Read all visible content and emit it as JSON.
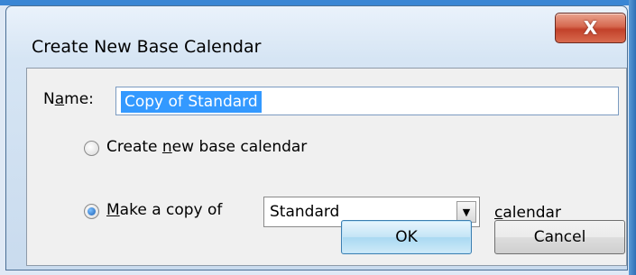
{
  "dialog": {
    "title": "Create New Base Calendar",
    "close_glyph": "X"
  },
  "name_field": {
    "label_prefix": "N",
    "label_mnemonic": "a",
    "label_suffix": "me:",
    "value": "Copy of Standard"
  },
  "options": {
    "create_new": {
      "label_prefix": "Create ",
      "label_mnemonic": "n",
      "label_suffix": "ew base calendar",
      "checked": false
    },
    "make_copy": {
      "label_mnemonic": "M",
      "label_suffix": "ake a copy of",
      "checked": true
    }
  },
  "calendar_select": {
    "selected": "Standard",
    "arrow_icon": "chevron-down-icon",
    "suffix_mnemonic": "c",
    "suffix_rest": "alendar"
  },
  "buttons": {
    "ok_label": "OK",
    "cancel_label": "Cancel"
  },
  "colors": {
    "selection": "#3399ff",
    "close_button": "#c2412a",
    "frame": "#3a86d4"
  }
}
